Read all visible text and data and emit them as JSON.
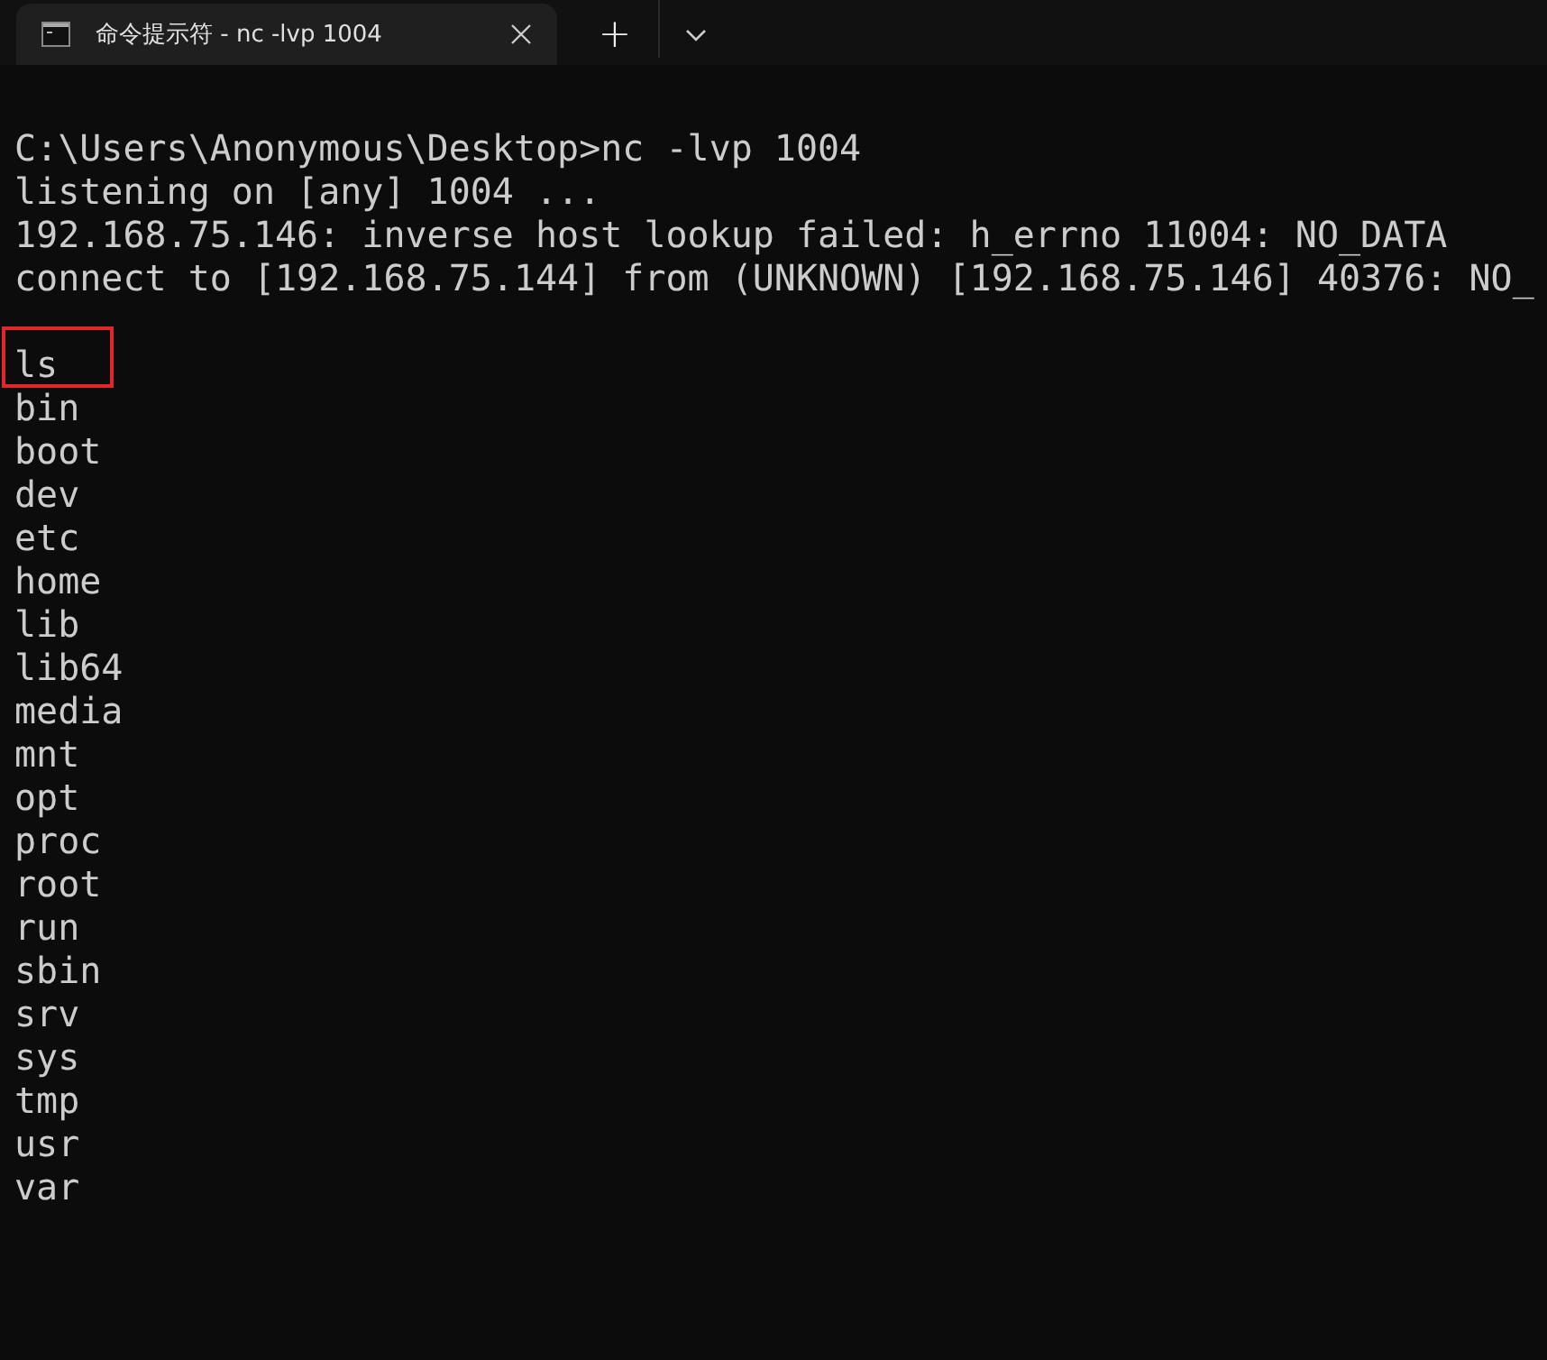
{
  "tabs": [
    {
      "title": "命令提示符 - nc  -lvp 1004",
      "selected": true
    }
  ],
  "new_tab": "+",
  "terminal": {
    "session_lines": [
      "C:\\Users\\Anonymous\\Desktop>nc -lvp 1004",
      "listening on [any] 1004 ...",
      "192.168.75.146: inverse host lookup failed: h_errno 11004: NO_DATA",
      "connect to [192.168.75.144] from (UNKNOWN) [192.168.75.146] 40376: NO_"
    ],
    "command": {
      "text": "ls",
      "highlighted": true
    },
    "output": [
      "bin",
      "boot",
      "dev",
      "etc",
      "home",
      "lib",
      "lib64",
      "media",
      "mnt",
      "opt",
      "proc",
      "root",
      "run",
      "sbin",
      "srv",
      "sys",
      "tmp",
      "usr",
      "var"
    ]
  }
}
